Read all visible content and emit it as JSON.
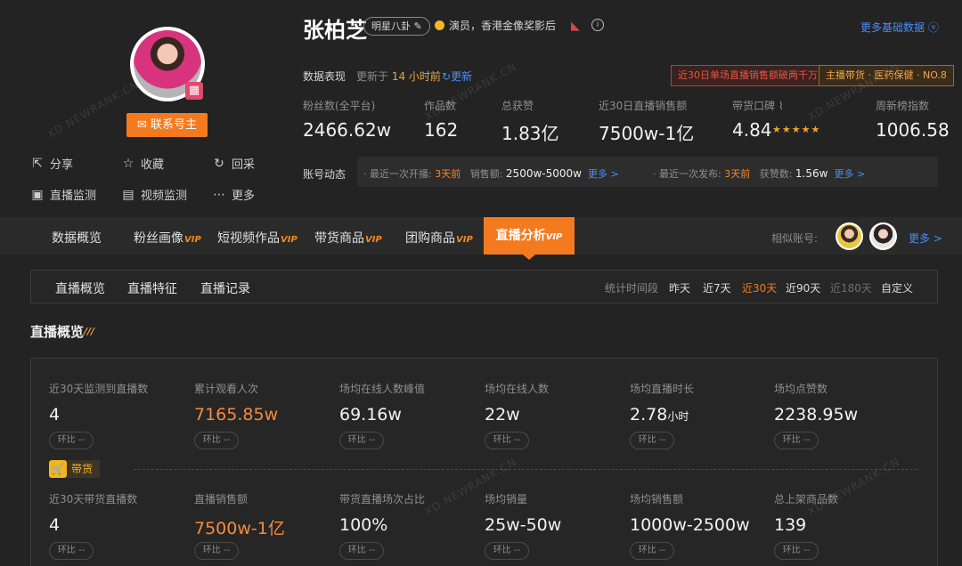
{
  "profile": {
    "name": "张柏芝",
    "category_tag": "明星八卦",
    "description": "演员，香港金像奖影后",
    "contact_button": "联系号主",
    "more_basic": "更多基础数据",
    "actions": [
      {
        "label": "分享",
        "icon": "share-icon"
      },
      {
        "label": "收藏",
        "icon": "star-icon"
      },
      {
        "label": "回采",
        "icon": "refresh-icon"
      },
      {
        "label": "直播监测",
        "icon": "tv-icon"
      },
      {
        "label": "视频监测",
        "icon": "chart-icon"
      },
      {
        "label": "更多",
        "icon": "more-icon"
      }
    ]
  },
  "data_section": {
    "title": "数据表现",
    "updated_prefix": "更新于",
    "updated_time": "14 小时前",
    "refresh": "更新",
    "badge_red": "近30日单场直播销售额破两千万",
    "badge_orange": "主播带货 · 医药保健 · NO.8"
  },
  "stats": [
    {
      "label": "粉丝数(全平台)",
      "value": "2466.62w"
    },
    {
      "label": "作品数",
      "value": "162"
    },
    {
      "label": "总获赞",
      "value": "1.83亿"
    },
    {
      "label": "近30日直播销售额",
      "value": "7500w-1亿"
    },
    {
      "label": "带货口碑",
      "value": "4.84",
      "rating": 5
    },
    {
      "label": "周新榜指数",
      "value": "1006.58"
    }
  ],
  "account_activity": {
    "label": "账号动态",
    "live_prefix": "· 最近一次开播:",
    "live_time": "3天前",
    "sales_label": "销售额:",
    "sales_value": "2500w-5000w",
    "more1": "更多 >",
    "post_prefix": "· 最近一次发布:",
    "post_time": "3天前",
    "likes_label": "获赞数:",
    "likes_value": "1.56w",
    "more2": "更多 >"
  },
  "tabs": [
    {
      "label": "数据概览",
      "vip": ""
    },
    {
      "label": "粉丝画像",
      "vip": "VIP"
    },
    {
      "label": "短视频作品",
      "vip": "VIP"
    },
    {
      "label": "带货商品",
      "vip": "VIP"
    },
    {
      "label": "团购商品",
      "vip": "VIP"
    },
    {
      "label": "直播分析",
      "vip": "VIP"
    }
  ],
  "similar": {
    "label": "相似账号:",
    "more": "更多 >"
  },
  "subtabs": [
    "直播概览",
    "直播特征",
    "直播记录"
  ],
  "period": {
    "label": "统计时间段",
    "options": [
      "昨天",
      "近7天",
      "近30天",
      "近90天",
      "近180天",
      "自定义"
    ]
  },
  "overview": {
    "title": "直播概览",
    "goods_label": "带货",
    "compare": "环比 --",
    "row1": [
      {
        "label": "近30天监测到直播数",
        "value": "4"
      },
      {
        "label": "累计观看人次",
        "value": "7165.85w"
      },
      {
        "label": "场均在线人数峰值",
        "value": "69.16w"
      },
      {
        "label": "场均在线人数",
        "value": "22w"
      },
      {
        "label": "场均直播时长",
        "value": "2.78",
        "unit": "小时"
      },
      {
        "label": "场均点赞数",
        "value": "2238.95w"
      }
    ],
    "row2": [
      {
        "label": "近30天带货直播数",
        "value": "4"
      },
      {
        "label": "直播销售额",
        "value": "7500w-1亿"
      },
      {
        "label": "带货直播场次占比",
        "value": "100%"
      },
      {
        "label": "场均销量",
        "value": "25w-50w"
      },
      {
        "label": "场均销售额",
        "value": "1000w-2500w"
      },
      {
        "label": "总上架商品数",
        "value": "139"
      }
    ]
  },
  "watermark": "XD.NEWRANK.CN",
  "colors": {
    "accent": "#f47a1f",
    "link": "#4b8df8",
    "value_highlight": "#f58a3d"
  }
}
